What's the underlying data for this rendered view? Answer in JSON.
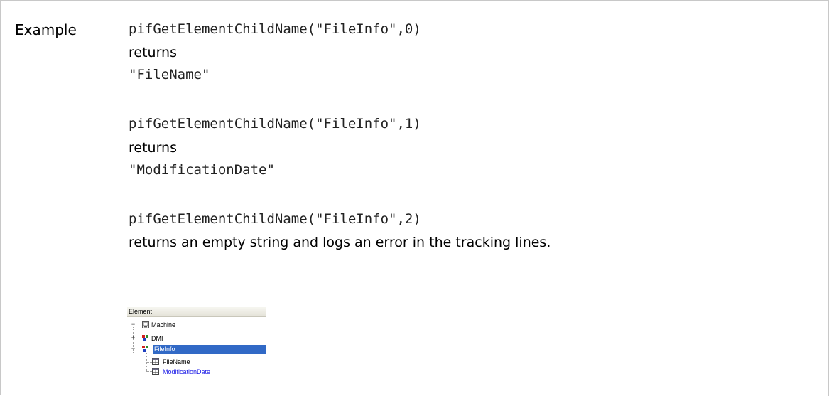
{
  "row": {
    "label": "Example"
  },
  "examples": [
    {
      "code": "pifGetElementChildName(\"FileInfo\",0)",
      "returns_label": "returns",
      "result": "\"FileName\""
    },
    {
      "code": "pifGetElementChildName(\"FileInfo\",1)",
      "returns_label": "returns",
      "result": "\"ModificationDate\""
    },
    {
      "code": "pifGetElementChildName(\"FileInfo\",2)",
      "returns_label": "returns an empty string and logs an error in the tracking lines."
    }
  ],
  "tree": {
    "header": "Element",
    "nodes": [
      {
        "label": "Machine",
        "expander": "−",
        "icon": "machine-icon"
      },
      {
        "label": "DMI",
        "expander": "+",
        "icon": "structure-icon"
      },
      {
        "label": "FileInfo",
        "expander": "−",
        "icon": "structure-icon",
        "selected": true
      },
      {
        "label": "FileName",
        "icon": "field-icon"
      },
      {
        "label": "ModificationDate",
        "icon": "field-icon",
        "color": "#1a1ae6"
      }
    ],
    "selection_color": "#3169c6"
  }
}
